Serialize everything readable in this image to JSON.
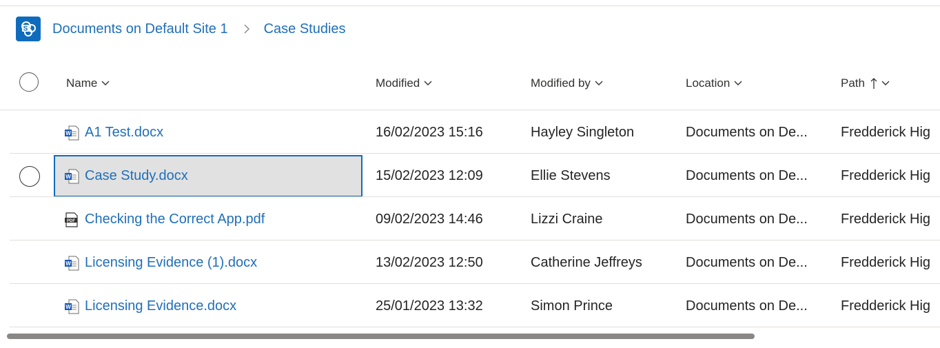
{
  "breadcrumb": {
    "site_label": "Documents on Default Site 1",
    "current_label": "Case Studies"
  },
  "columns": {
    "name": "Name",
    "modified": "Modified",
    "modified_by": "Modified by",
    "location": "Location",
    "path": "Path"
  },
  "rows": [
    {
      "name": "A1 Test.docx",
      "file_type": "word",
      "modified": "16/02/2023 15:16",
      "modified_by": "Hayley Singleton",
      "location": "Documents on De...",
      "path": "Fredderick Hig"
    },
    {
      "name": "Case Study.docx",
      "file_type": "word",
      "modified": "15/02/2023 12:09",
      "modified_by": "Ellie Stevens",
      "location": "Documents on De...",
      "path": "Fredderick Hig",
      "focused": true
    },
    {
      "name": "Checking the Correct App.pdf",
      "file_type": "pdf",
      "modified": "09/02/2023 14:46",
      "modified_by": "Lizzi Craine",
      "location": "Documents on De...",
      "path": "Fredderick Hig"
    },
    {
      "name": "Licensing Evidence (1).docx",
      "file_type": "word",
      "modified": "13/02/2023 12:50",
      "modified_by": "Catherine Jeffreys",
      "location": "Documents on De...",
      "path": "Fredderick Hig"
    },
    {
      "name": "Licensing Evidence.docx",
      "file_type": "word",
      "modified": "25/01/2023 13:32",
      "modified_by": "Simon Prince",
      "location": "Documents on De...",
      "path": "Fredderick Hig"
    }
  ],
  "sort": {
    "column": "path",
    "direction": "ascending"
  },
  "colors": {
    "accent": "#0f6cbd",
    "link": "#1f6fba",
    "focus_bg": "#e1e1e1",
    "divider": "#e1dfdd"
  },
  "icons": {
    "site_logo": "sharepoint-icon",
    "word": "word-document-icon",
    "pdf": "pdf-document-icon",
    "separator": "chevron-right-icon",
    "column_menu": "chevron-down-icon",
    "sort": "arrow-up-icon"
  }
}
